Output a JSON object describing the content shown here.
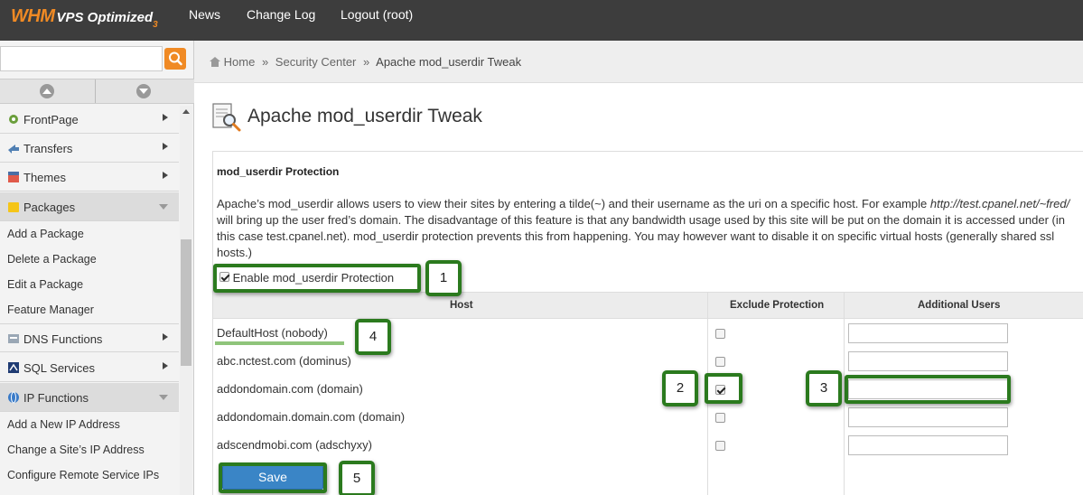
{
  "topbar": {
    "logo_main": "WHM",
    "logo_sub": "VPS Optimized",
    "logo_version": "3",
    "nav": [
      {
        "label": "News"
      },
      {
        "label": "Change Log"
      },
      {
        "label": "Logout (root)"
      }
    ]
  },
  "breadcrumb": {
    "items": [
      "Home",
      "Security Center"
    ],
    "separator": "»",
    "current": "Apache mod_userdir Tweak"
  },
  "sidebar": {
    "search_placeholder": "",
    "categories": [
      {
        "label": "FrontPage",
        "icon": "frontpage-icon",
        "open": false
      },
      {
        "label": "Transfers",
        "icon": "transfers-icon",
        "open": false
      },
      {
        "label": "Themes",
        "icon": "themes-icon",
        "open": false
      },
      {
        "label": "Packages",
        "icon": "packages-icon",
        "open": true,
        "items": [
          "Add a Package",
          "Delete a Package",
          "Edit a Package",
          "Feature Manager"
        ]
      },
      {
        "label": "DNS Functions",
        "icon": "dns-icon",
        "open": false
      },
      {
        "label": "SQL Services",
        "icon": "sql-icon",
        "open": false
      },
      {
        "label": "IP Functions",
        "icon": "ip-icon",
        "open": true,
        "items": [
          "Add a New IP Address",
          "Change a Site’s IP Address",
          "Configure Remote Service IPs"
        ]
      }
    ]
  },
  "main": {
    "title": "Apache mod_userdir Tweak",
    "section_title": "mod_userdir Protection",
    "description_part1": "Apache’s mod_userdir allows users to view their sites by entering a tilde(~) and their username as the uri on a specific host. For example ",
    "description_url": "http://test.cpanel.net/~fred/",
    "description_part2": " will bring up the user fred’s domain. The disadvantage of this feature is that any bandwidth usage used by this site will be put on the domain it is accessed under (in this case test.cpanel.net). mod_userdir protection prevents this from happening. You may however want to disable it on specific virtual hosts (generally shared ssl hosts.)",
    "enable_label": "Enable mod_userdir Protection",
    "enable_checked": true,
    "table": {
      "headers": [
        "Host",
        "Exclude Protection",
        "Additional Users"
      ],
      "rows": [
        {
          "host": "DefaultHost (nobody)",
          "exclude": false,
          "users": ""
        },
        {
          "host": "abc.nctest.com (dominus)",
          "exclude": false,
          "users": ""
        },
        {
          "host": "addondomain.com (domain)",
          "exclude": true,
          "users": ""
        },
        {
          "host": "addondomain.domain.com (domain)",
          "exclude": false,
          "users": ""
        },
        {
          "host": "adscendmobi.com (adschyxy)",
          "exclude": false,
          "users": ""
        }
      ]
    },
    "save_label": "Save"
  },
  "annotations": {
    "badges": [
      "1",
      "2",
      "3",
      "4",
      "5"
    ],
    "color": "#2b7a1e"
  },
  "colors": {
    "accent": "#f08a24",
    "topbar": "#3d3d3d",
    "save_button": "#3a85c6"
  }
}
